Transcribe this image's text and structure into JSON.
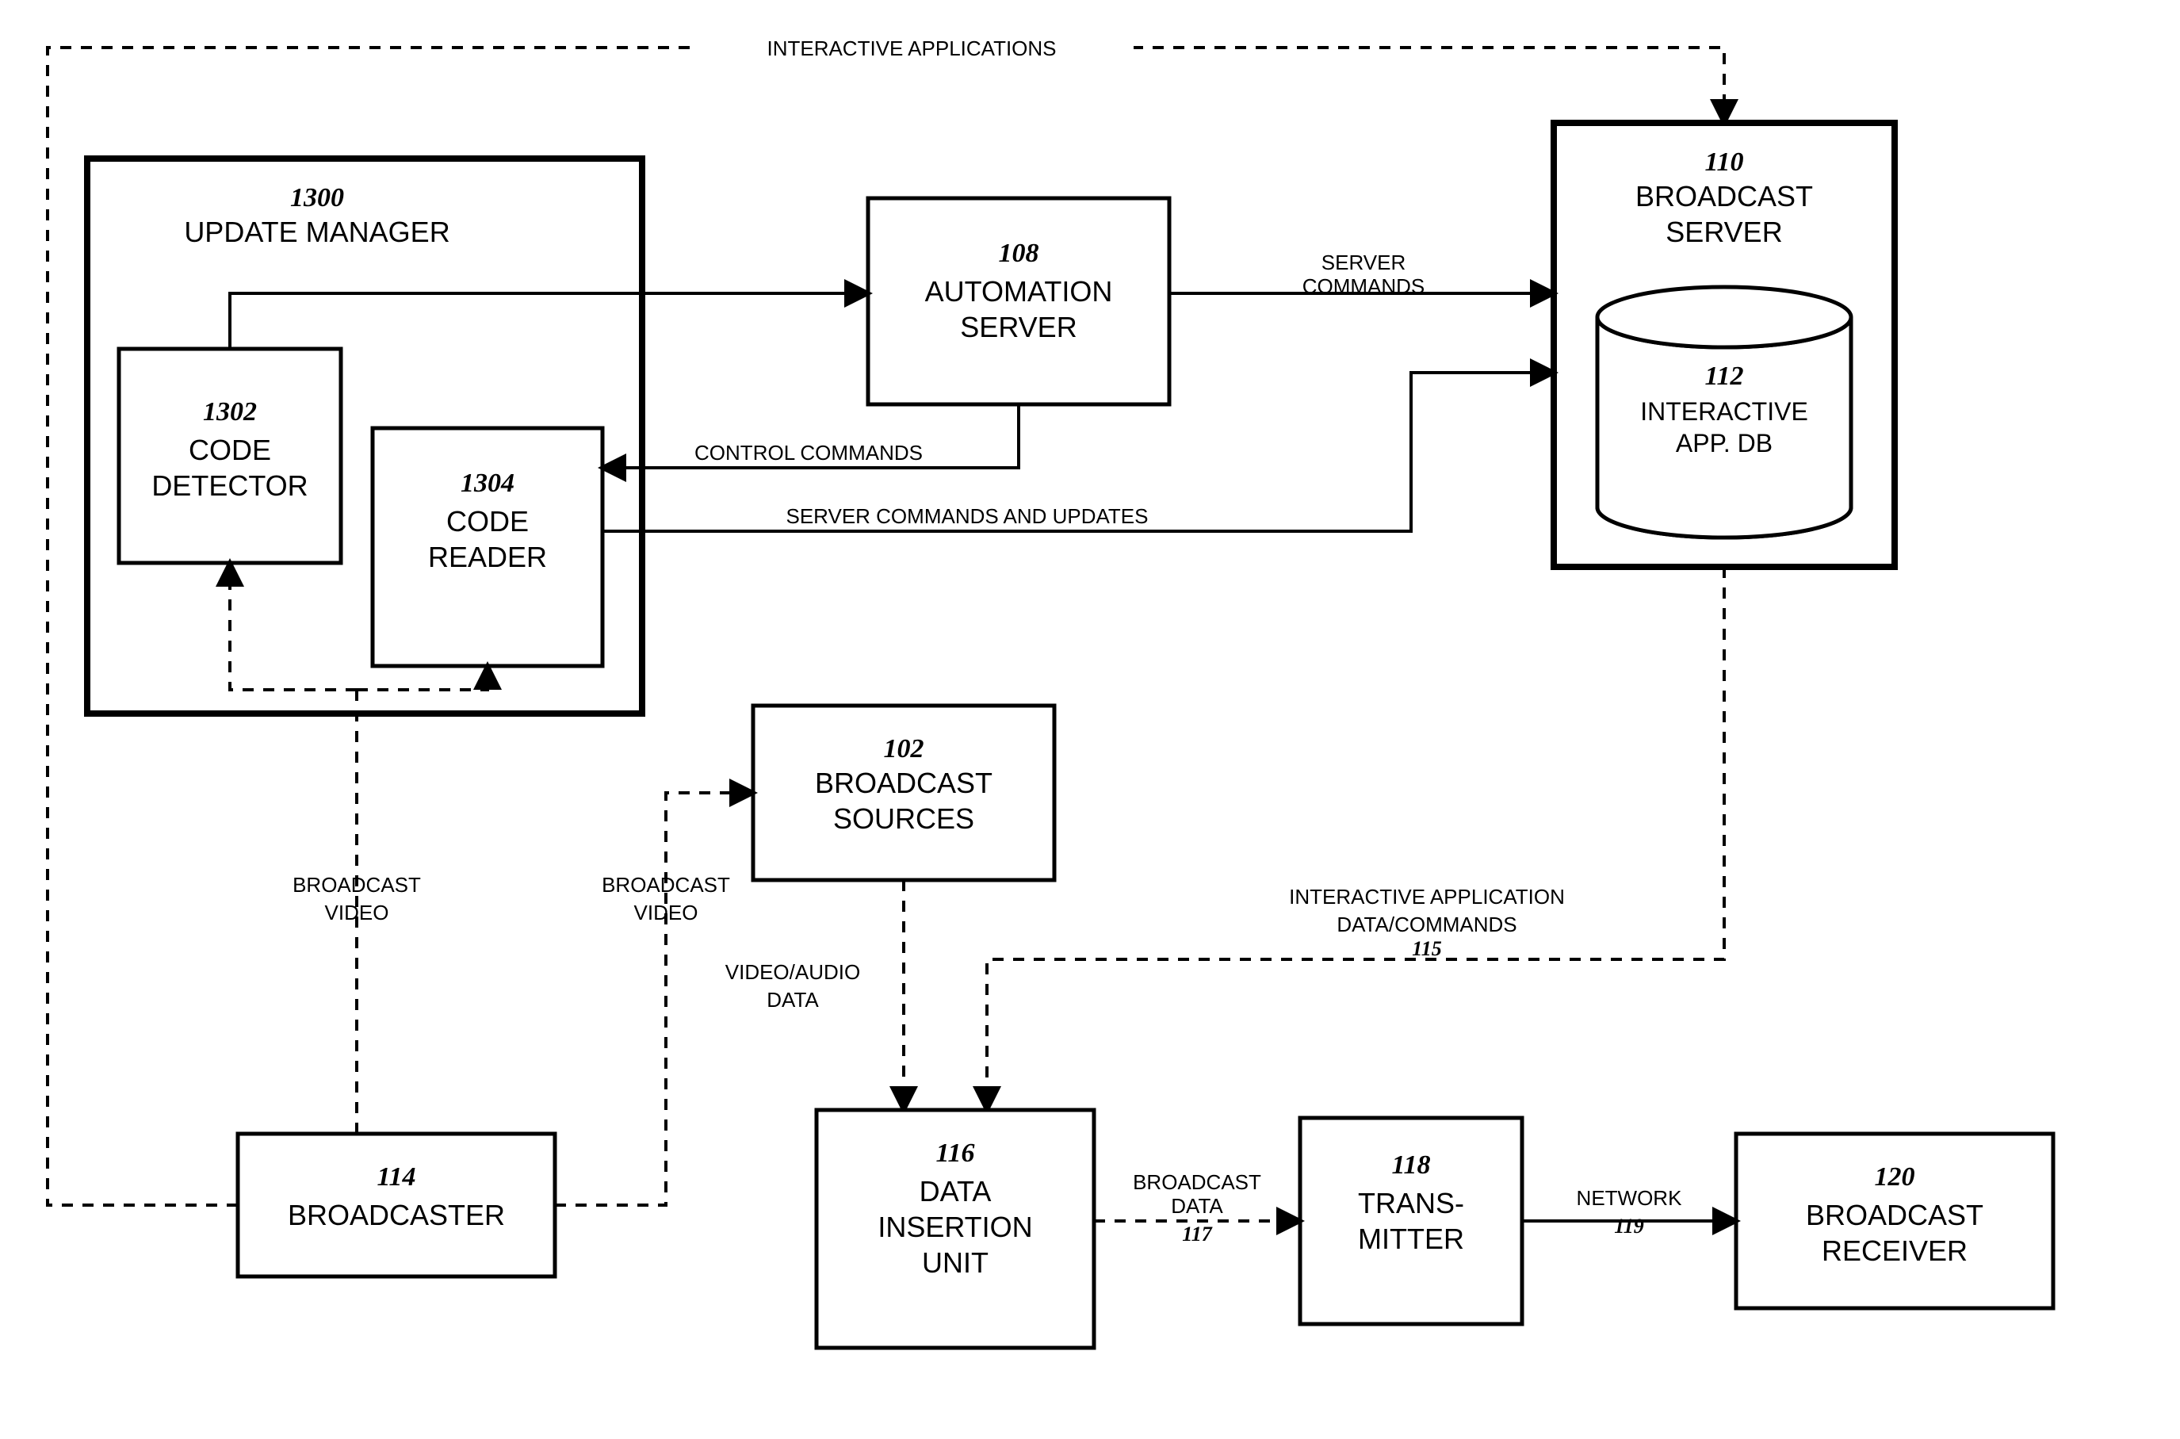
{
  "title_edge": "INTERACTIVE APPLICATIONS",
  "blocks": {
    "update_manager": {
      "num": "1300",
      "name": "UPDATE MANAGER"
    },
    "code_detector": {
      "num": "1302",
      "name": "CODE DETECTOR"
    },
    "code_reader": {
      "num": "1304",
      "name": "CODE READER"
    },
    "automation": {
      "num": "108",
      "name": "AUTOMATION SERVER"
    },
    "broadcast_srv": {
      "num": "110",
      "name": "BROADCAST SERVER"
    },
    "app_db": {
      "num": "112",
      "name": "INTERACTIVE APP. DB"
    },
    "broadcast_src": {
      "num": "102",
      "name": "BROADCAST SOURCES"
    },
    "broadcaster": {
      "num": "114",
      "name": "BROADCASTER"
    },
    "data_ins": {
      "num": "116",
      "name": "DATA INSERTION UNIT"
    },
    "transmitter": {
      "num": "118",
      "name": "TRANS-MITTER"
    },
    "receiver": {
      "num": "120",
      "name": "BROADCAST RECEIVER"
    }
  },
  "edges": {
    "server_cmds": "SERVER COMMANDS",
    "control_cmds": "CONTROL COMMANDS",
    "server_cmds_upd": "SERVER COMMANDS AND UPDATES",
    "bcast_video1": "BROADCAST VIDEO",
    "bcast_video2": "BROADCAST VIDEO",
    "va_data": "VIDEO/AUDIO DATA",
    "iad": "INTERACTIVE APPLICATION DATA/COMMANDS",
    "iad_num": "115",
    "bcast_data": "BROADCAST DATA",
    "bcast_data_num": "117",
    "network": "NETWORK",
    "network_num": "119"
  }
}
